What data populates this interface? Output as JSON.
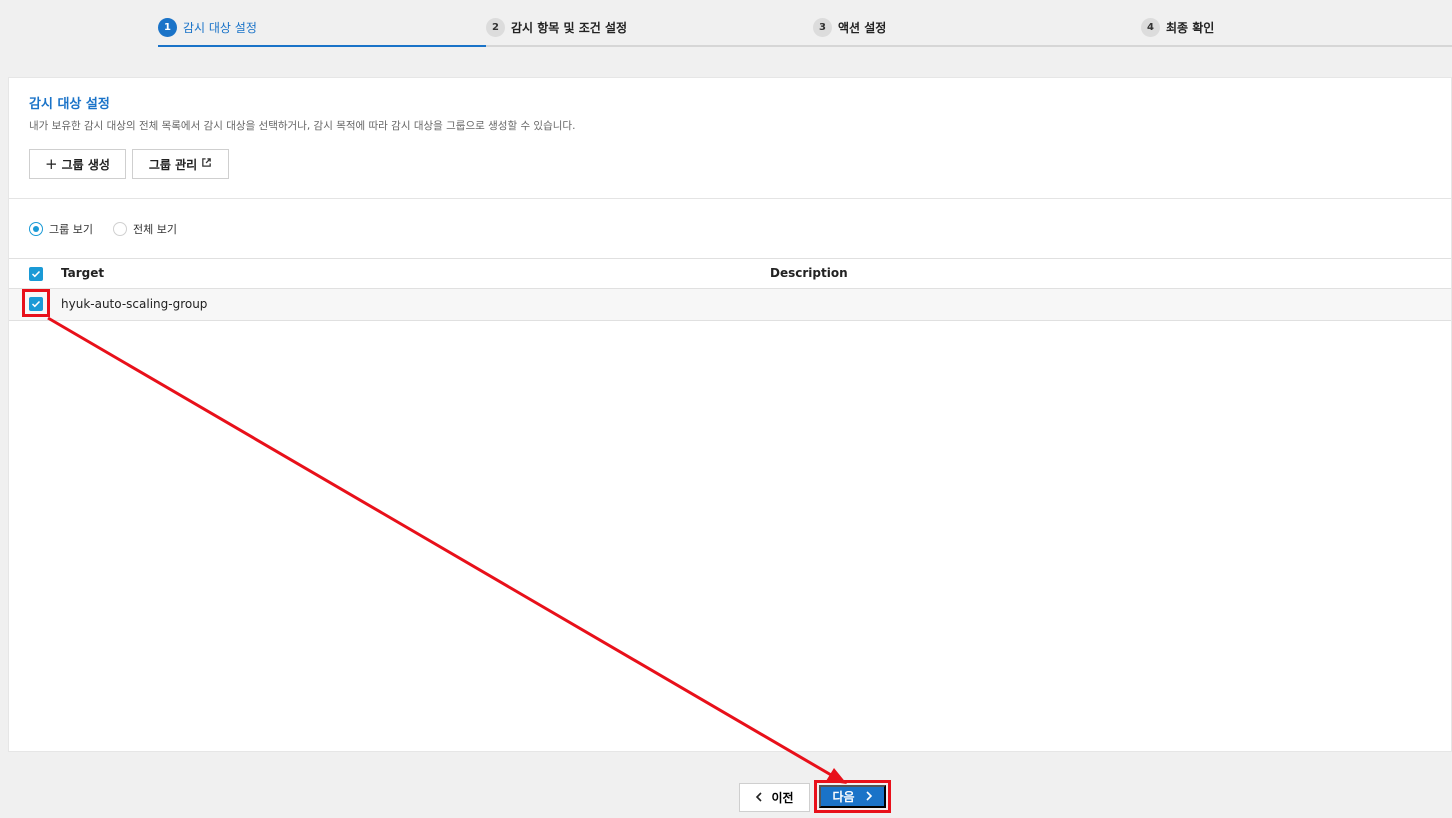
{
  "stepper": {
    "steps": [
      {
        "num": "1",
        "label": "감시 대상 설정"
      },
      {
        "num": "2",
        "label": "감시 항목 및 조건 설정"
      },
      {
        "num": "3",
        "label": "액션 설정"
      },
      {
        "num": "4",
        "label": "최종 확인"
      }
    ]
  },
  "section": {
    "title": "감시 대상 설정",
    "description": "내가 보유한 감시 대상의 전체 목록에서 감시 대상을 선택하거나, 감시 목적에 따라 감시 대상을 그룹으로 생성할 수 있습니다."
  },
  "buttons": {
    "create_group": "그룹 생성",
    "manage_group": "그룹 관리"
  },
  "view_options": [
    {
      "label": "그룹 보기",
      "checked": true
    },
    {
      "label": "전체 보기",
      "checked": false
    }
  ],
  "table": {
    "columns": [
      "Target",
      "Description"
    ],
    "rows": [
      {
        "target": "hyuk-auto-scaling-group",
        "description": ""
      }
    ]
  },
  "footer": {
    "prev_label": "이전",
    "next_label": "다음"
  },
  "colors": {
    "accent": "#1a73c8",
    "checkbox": "#1a9ad6",
    "annotation": "#e8101a"
  }
}
